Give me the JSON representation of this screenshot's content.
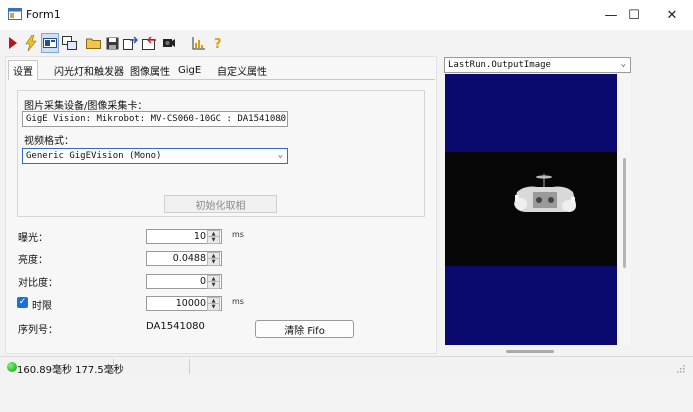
{
  "window": {
    "title": "Form1",
    "minimize": "—",
    "maximize": "☐",
    "close": "✕"
  },
  "toolbar": {
    "icons": [
      "run-icon",
      "lightning-icon",
      "display-icon",
      "copy-images-icon",
      "open-folder-icon",
      "save-icon",
      "export-icon",
      "import-icon",
      "camera-icon",
      "chart-icon",
      "help-icon"
    ]
  },
  "tabs": [
    {
      "label": "设置"
    },
    {
      "label": "闪光灯和触发器"
    },
    {
      "label": "图像属性"
    },
    {
      "label": "GigE"
    },
    {
      "label": "自定义属性"
    }
  ],
  "settings": {
    "device_label": "图片采集设备/图像采集卡：",
    "device_value": "GigE Vision: Mikrobot: MV-CS060-10GC : DA1541080",
    "format_label": "视频格式：",
    "format_value": "Generic GigEVision (Mono)",
    "init_button": "初始化取相",
    "exposure_label": "曝光：",
    "exposure_value": "10",
    "exposure_unit": "ms",
    "brightness_label": "亮度：",
    "brightness_value": "0.0488",
    "contrast_label": "对比度：",
    "contrast_value": "0",
    "timeout_label": "时限",
    "timeout_value": "10000",
    "timeout_unit": "ms",
    "timeout_checked": true,
    "serial_label": "序列号：",
    "serial_value": "DA1541080",
    "clear_fifo": "清除 Fifo"
  },
  "image": {
    "source_value": "LastRun.OutputImage",
    "colors": {
      "background": "#0a0a6e",
      "band": "#070707"
    }
  },
  "status": {
    "indicator_color": "#11b311",
    "text": "160.89毫秒 177.5毫秒"
  }
}
